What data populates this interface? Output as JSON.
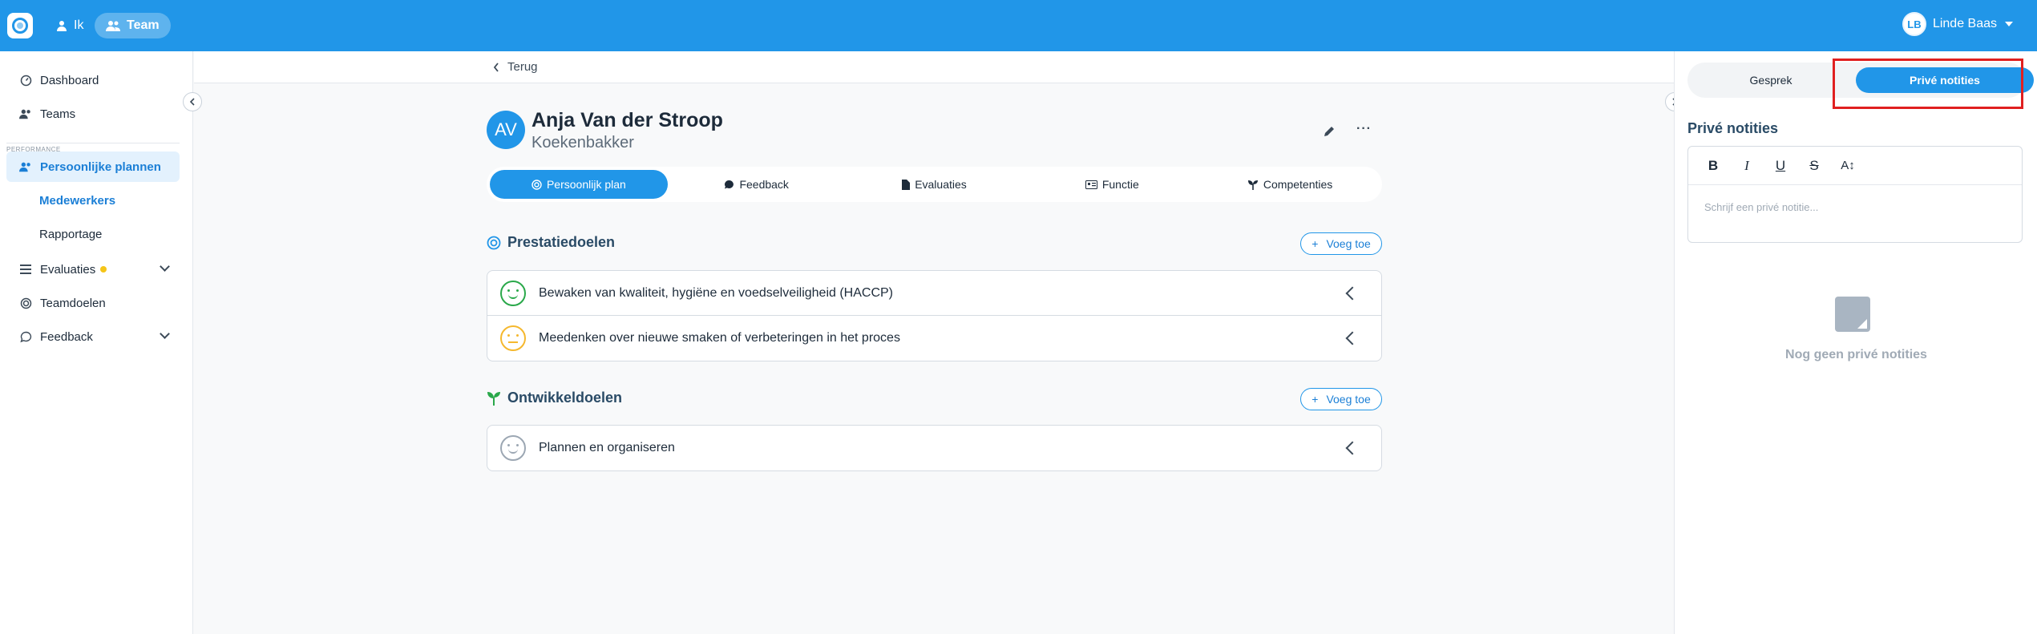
{
  "topbar": {
    "nav_me": "Ik",
    "nav_team": "Team",
    "user_initials": "LB",
    "user_name": "Linde Baas"
  },
  "sidebar": {
    "items": [
      {
        "label": "Dashboard",
        "icon": "dashboard-icon"
      },
      {
        "label": "Teams",
        "icon": "teams-icon"
      }
    ],
    "section_label": "PERFORMANCE",
    "active_item": "Persoonlijke plannen",
    "sub_items": [
      "Medewerkers",
      "Rapportage"
    ],
    "more_items": [
      {
        "label": "Evaluaties",
        "icon": "list-icon"
      },
      {
        "label": "Teamdoelen",
        "icon": "target-icon"
      },
      {
        "label": "Feedback",
        "icon": "chat-icon"
      }
    ]
  },
  "main": {
    "back_label": "Terug",
    "profile": {
      "initials": "AV",
      "name": "Anja Van der Stroop",
      "role": "Koekenbakker"
    },
    "tabs": [
      {
        "label": "Persoonlijk plan",
        "icon": "target-icon"
      },
      {
        "label": "Feedback",
        "icon": "chat-icon"
      },
      {
        "label": "Evaluaties",
        "icon": "document-icon"
      },
      {
        "label": "Functie",
        "icon": "id-card-icon"
      },
      {
        "label": "Competenties",
        "icon": "sprout-icon"
      }
    ],
    "performance_goals": {
      "title": "Prestatiedoelen",
      "add_label": "Voeg toe",
      "items": [
        {
          "label": "Bewaken van kwaliteit, hygiëne en voedselveiligheid (HACCP)",
          "mood": "happy"
        },
        {
          "label": "Meedenken over nieuwe smaken of verbeteringen in het proces",
          "mood": "neutral"
        }
      ]
    },
    "development_goals": {
      "title": "Ontwikkeldoelen",
      "add_label": "Voeg toe",
      "items": [
        {
          "label": "Plannen en organiseren",
          "mood": "none"
        }
      ]
    }
  },
  "right_panel": {
    "tab_conversation": "Gesprek",
    "tab_private": "Privé notities",
    "title": "Privé notities",
    "editor_placeholder": "Schrijf een privé notitie...",
    "empty_text": "Nog geen privé notities",
    "toolbar": [
      "B",
      "I",
      "U",
      "S",
      "A↕"
    ]
  },
  "colors": {
    "brand": "#2196e8",
    "highlight": "#e02020"
  }
}
